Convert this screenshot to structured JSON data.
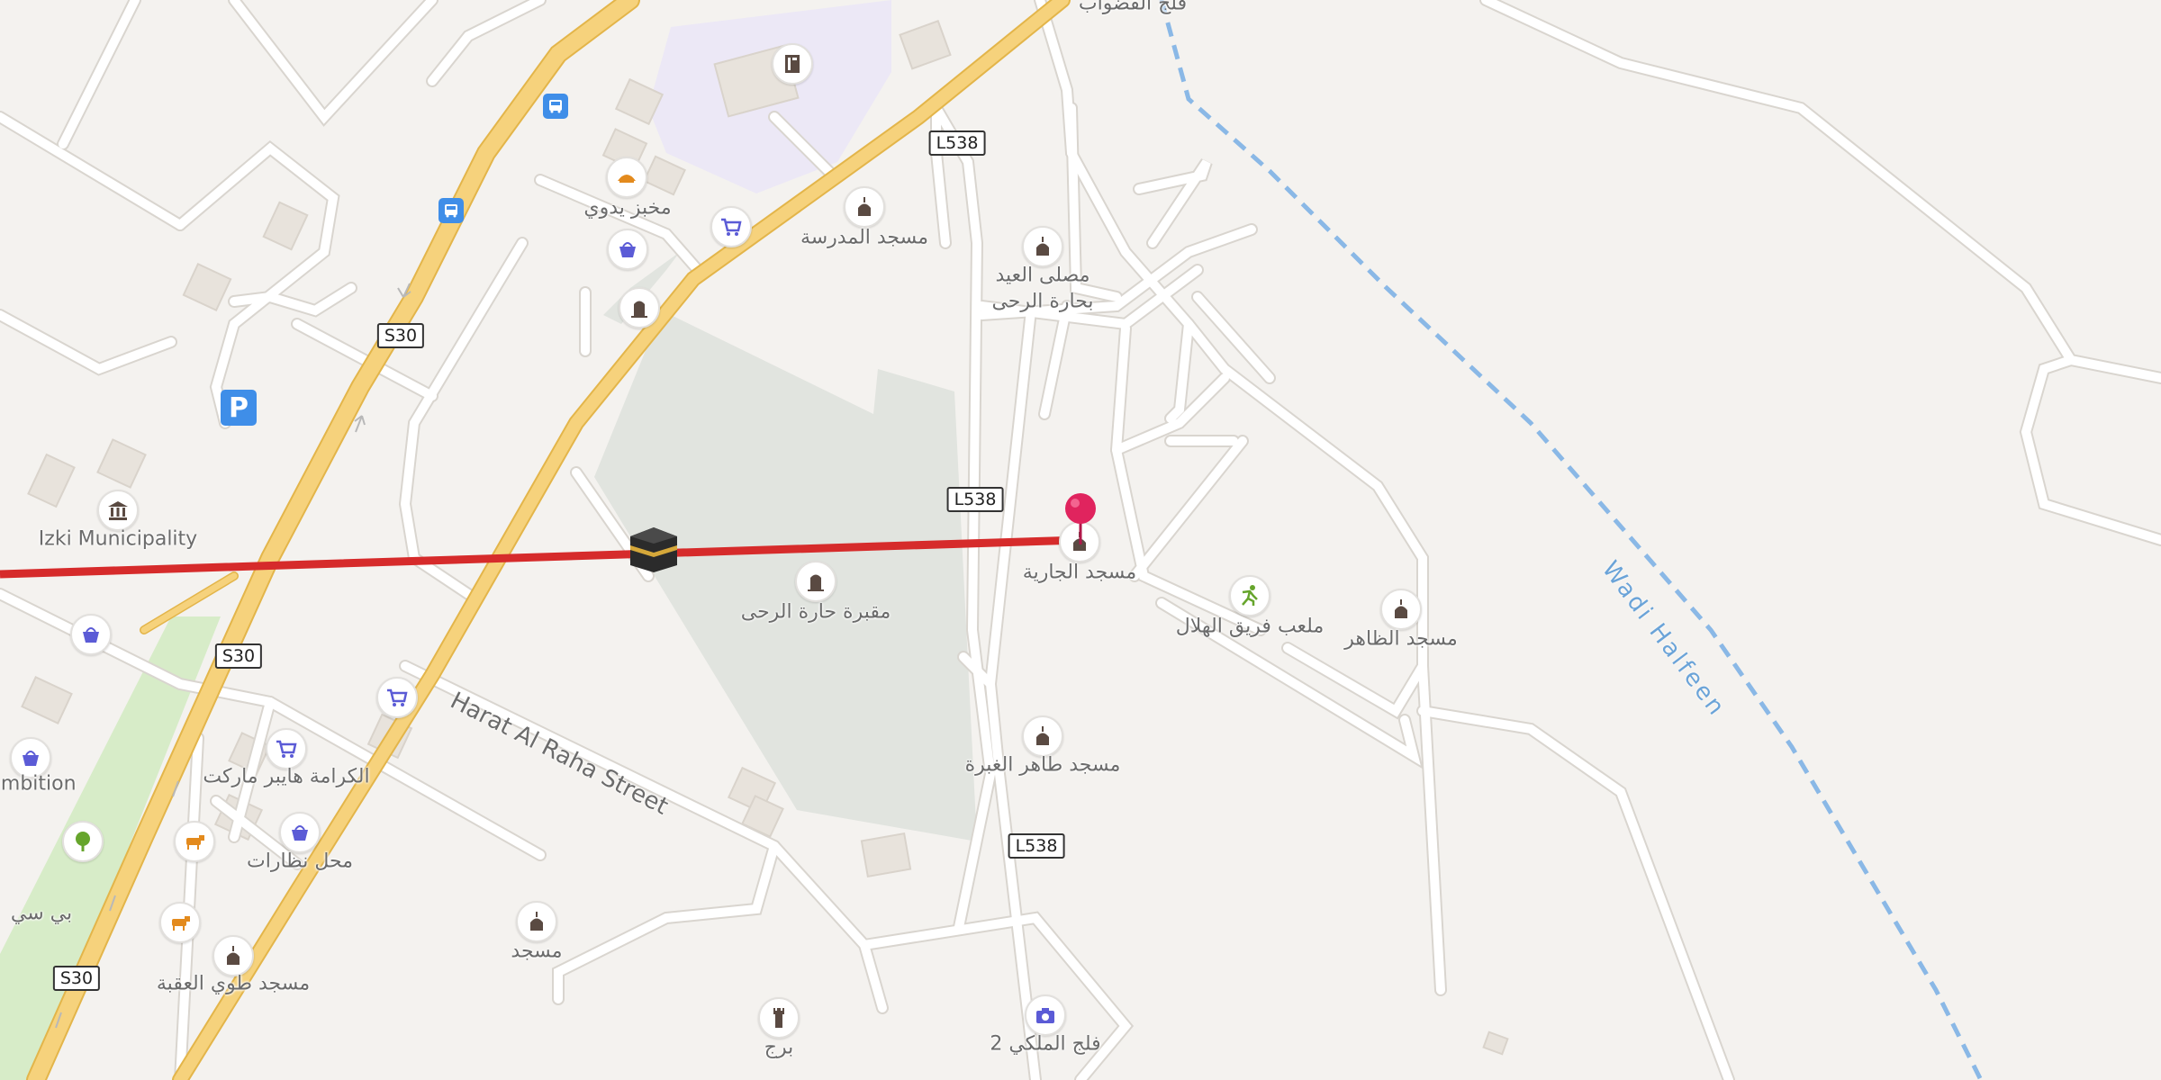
{
  "map": {
    "place_labels": [
      {
        "id": "l1",
        "text": "فلج القضواب"
      },
      {
        "id": "l2",
        "text": "مخبز يدوي"
      },
      {
        "id": "l3",
        "text": "مسجد المدرسة"
      },
      {
        "id": "l4",
        "text": "مصلى العيد"
      },
      {
        "id": "l5",
        "text": "بحارة الرحى"
      },
      {
        "id": "l6",
        "text": "Izki Municipality"
      },
      {
        "id": "l7",
        "text": "مقبرة حارة الرحى"
      },
      {
        "id": "l8",
        "text": "مسجد الجارية"
      },
      {
        "id": "l9",
        "text": "ملعب فريق الهلال"
      },
      {
        "id": "l10",
        "text": "مسجد الظاهر"
      },
      {
        "id": "l11",
        "text": "مسجد طاهر الغبرة"
      },
      {
        "id": "l12",
        "text": "الكرامة هايبر ماركت"
      },
      {
        "id": "l13",
        "text": "محل نظارات"
      },
      {
        "id": "l14",
        "text": "ambition"
      },
      {
        "id": "l15",
        "text": "بي سي"
      },
      {
        "id": "l16",
        "text": "مسجد"
      },
      {
        "id": "l17",
        "text": "مسجد طوي العقبة"
      },
      {
        "id": "l18",
        "text": "برج"
      },
      {
        "id": "l19",
        "text": "فلج الملكي 2"
      }
    ],
    "street_name": "Harat Al Raha Street",
    "waterway_name": "Wadi Halfeen",
    "road_refs": {
      "s30_1": "S30",
      "s30_2": "S30",
      "s30_3": "S30",
      "l538_1": "L538",
      "l538_2": "L538",
      "l538_3": "L538"
    },
    "parking_symbol": "P",
    "icons": [
      "mosque-icon",
      "bakery-icon",
      "shop-basket-icon",
      "cart-icon",
      "bus-stop-icon",
      "parking-icon",
      "townhall-icon",
      "cemetery-icon",
      "school-icon",
      "sports-icon",
      "cow-icon",
      "tree-icon",
      "camera-icon",
      "tower-icon",
      "kaaba-icon",
      "location-pin-icon"
    ],
    "colors": {
      "background": "#f4f2ef",
      "primary_road": "#f6d27c",
      "road_casing": "#e3b54a",
      "minor_road": "#ffffff",
      "route_line": "#d62b2b",
      "waterway": "#8ab8e6",
      "cemetery": "#e1e4df",
      "school_area": "#ece8f6",
      "park": "#d7ecc8",
      "pin": "#e0245e"
    }
  }
}
